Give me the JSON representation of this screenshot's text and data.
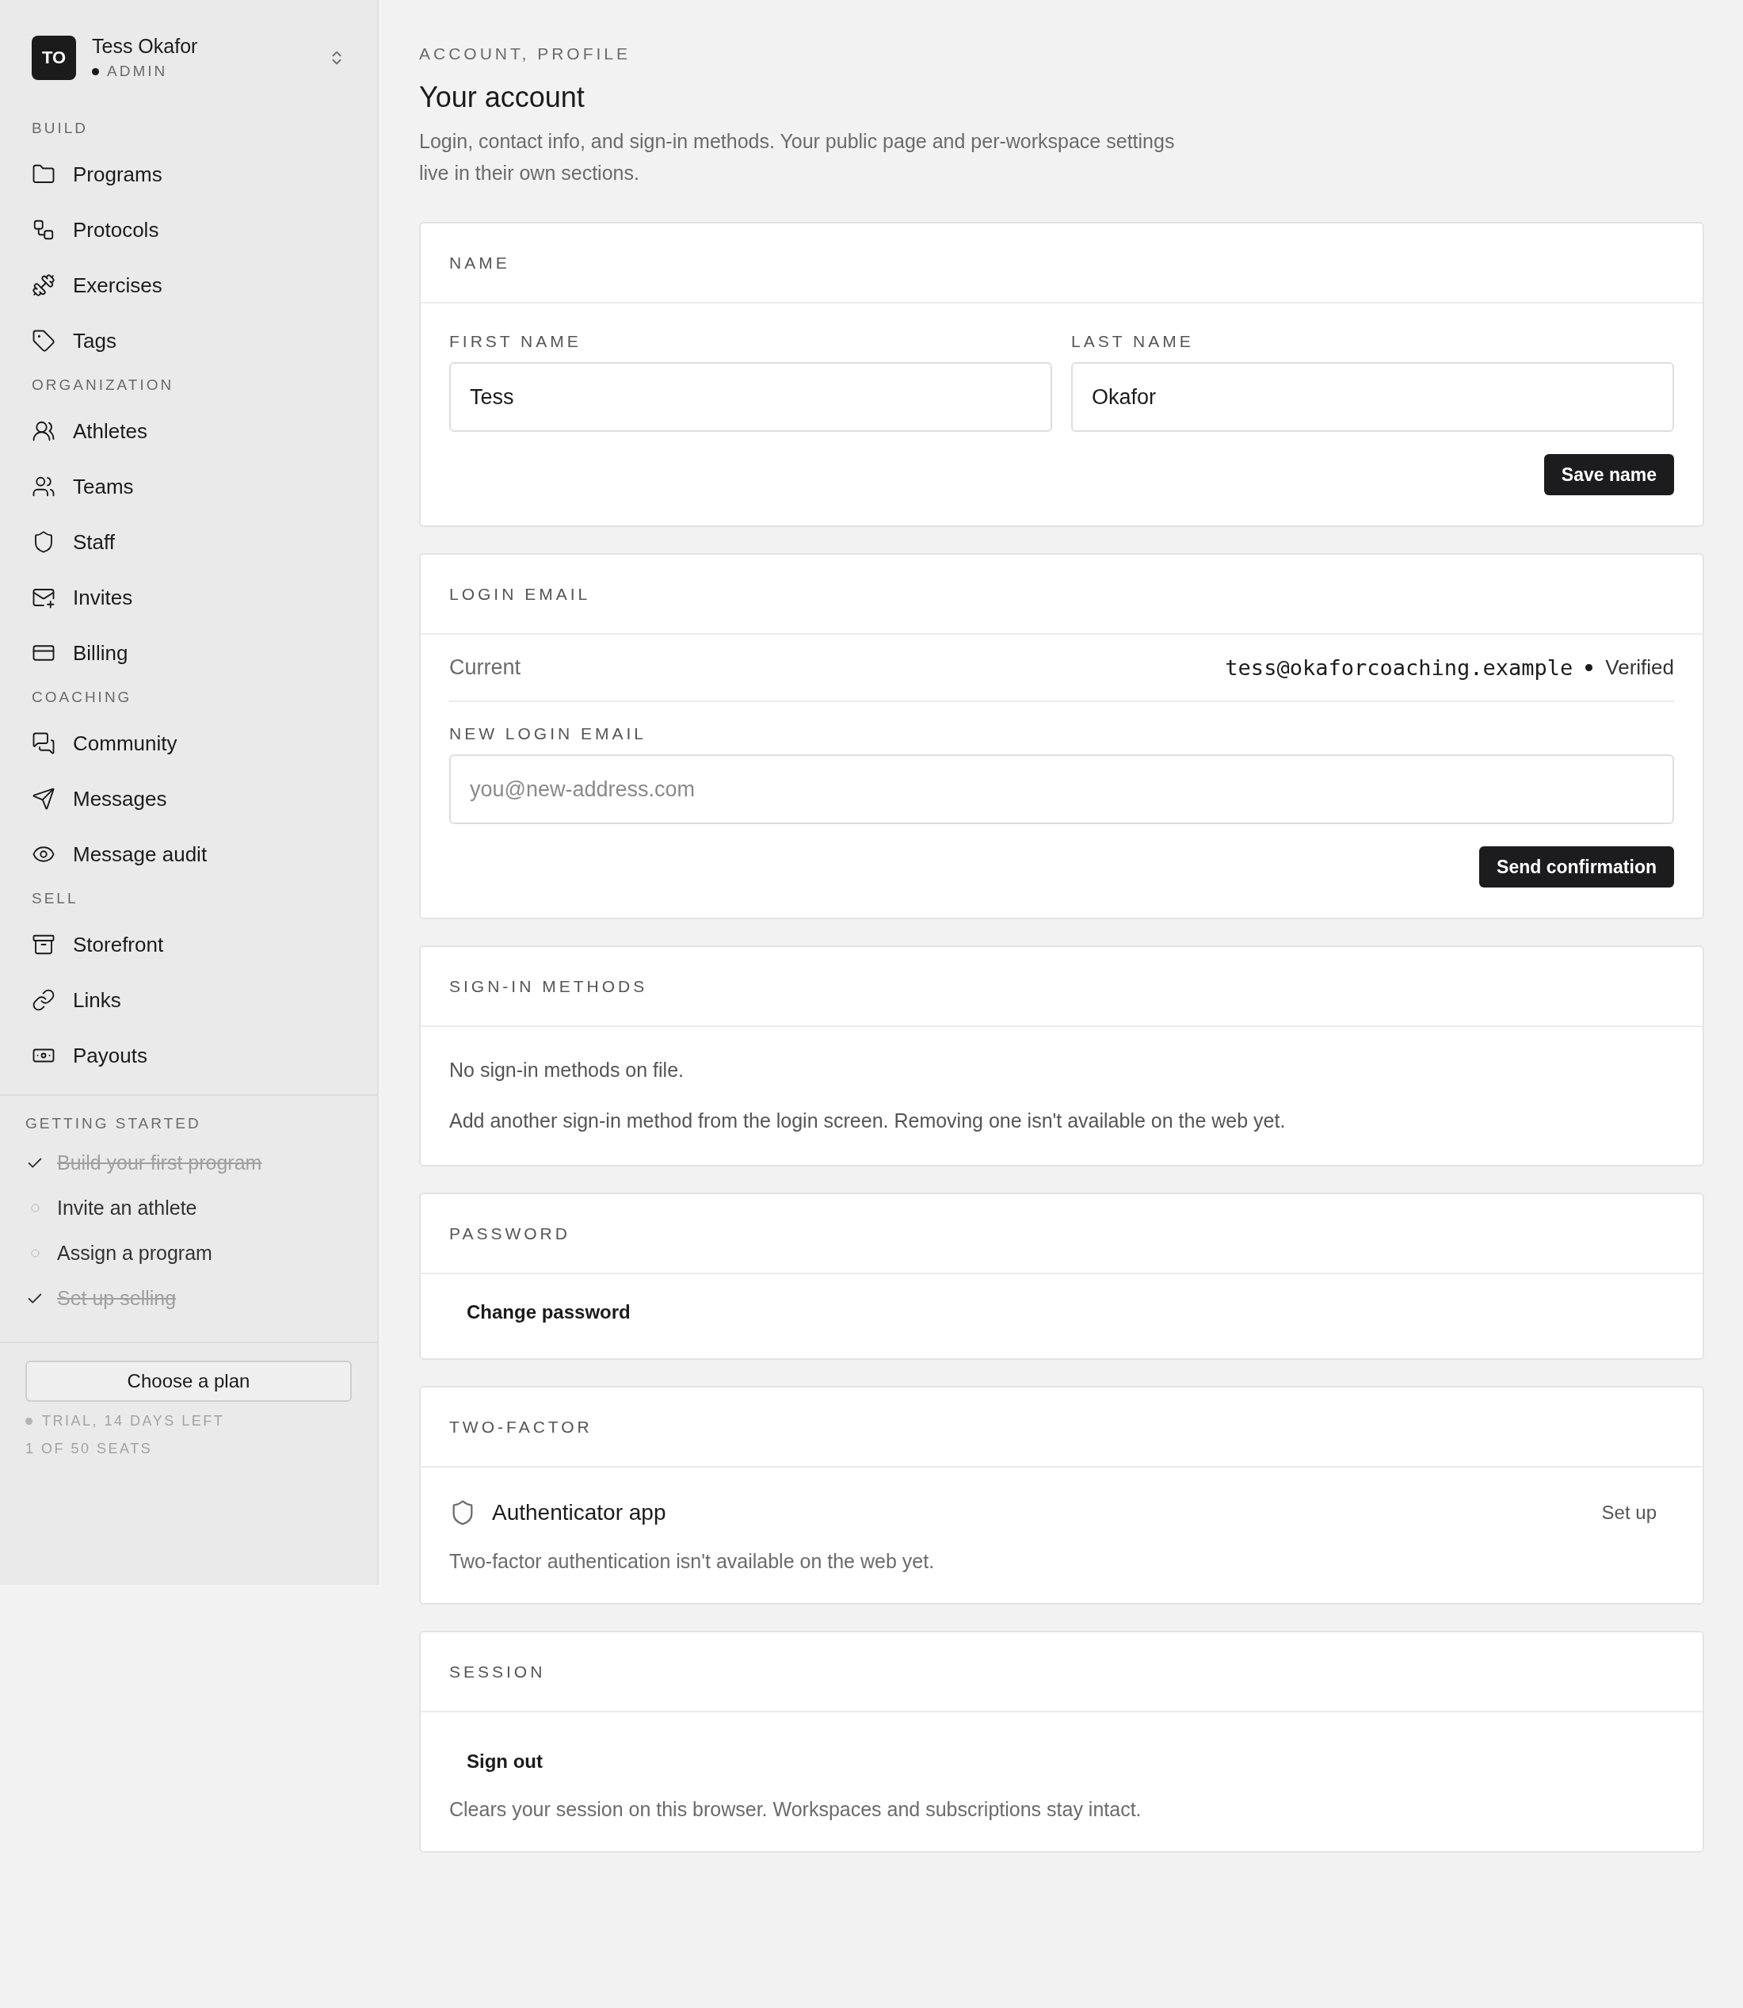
{
  "sidebar": {
    "account": {
      "initials": "TO",
      "name": "Tess Okafor",
      "role": "ADMIN"
    },
    "sections": [
      {
        "title": "BUILD",
        "items": [
          {
            "label": "Programs"
          },
          {
            "label": "Protocols"
          },
          {
            "label": "Exercises"
          },
          {
            "label": "Tags"
          }
        ]
      },
      {
        "title": "ORGANIZATION",
        "items": [
          {
            "label": "Athletes"
          },
          {
            "label": "Teams"
          },
          {
            "label": "Staff"
          },
          {
            "label": "Invites"
          },
          {
            "label": "Billing"
          }
        ]
      },
      {
        "title": "COACHING",
        "items": [
          {
            "label": "Community"
          },
          {
            "label": "Messages"
          },
          {
            "label": "Message audit"
          }
        ]
      },
      {
        "title": "SELL",
        "items": [
          {
            "label": "Storefront"
          },
          {
            "label": "Links"
          },
          {
            "label": "Payouts"
          }
        ]
      }
    ],
    "getting_started": {
      "title": "GETTING STARTED",
      "items": [
        {
          "label": "Build your first program",
          "done": true
        },
        {
          "label": "Invite an athlete",
          "done": false
        },
        {
          "label": "Assign a program",
          "done": false
        },
        {
          "label": "Set up selling",
          "done": true
        }
      ]
    },
    "plan_button": "Choose a plan",
    "trial_status": "TRIAL, 14 DAYS LEFT",
    "seats": "1 OF 50 SEATS"
  },
  "main": {
    "breadcrumb": "ACCOUNT, PROFILE",
    "title": "Your account",
    "description": "Login, contact info, and sign-in methods. Your public page and per-workspace settings live in their own sections.",
    "cards": [
      {
        "kind": "name",
        "title": "NAME",
        "fields": [
          {
            "label": "FIRST NAME",
            "value": "Tess"
          },
          {
            "label": "LAST NAME",
            "value": "Okafor"
          }
        ],
        "button": "Save name"
      },
      {
        "kind": "email",
        "title": "LOGIN EMAIL",
        "current_label": "Current",
        "current_value": "tess@okaforcoaching.example",
        "status": "Verified",
        "field_label": "NEW LOGIN EMAIL",
        "placeholder": "you@new-address.com",
        "button": "Send confirmation"
      },
      {
        "kind": "methods",
        "title": "SIGN-IN METHODS",
        "lines": [
          "No sign-in methods on file.",
          "Add another sign-in method from the login screen. Removing one isn't available on the web yet."
        ]
      },
      {
        "kind": "password",
        "title": "PASSWORD",
        "button": "Change password"
      },
      {
        "kind": "twofactor",
        "title": "TWO-FACTOR",
        "method": "Authenticator app",
        "action": "Set up",
        "note": "Two-factor authentication isn't available on the web yet."
      },
      {
        "kind": "session",
        "title": "SESSION",
        "button": "Sign out",
        "note": "Clears your session on this browser. Workspaces and subscriptions stay intact."
      }
    ]
  }
}
